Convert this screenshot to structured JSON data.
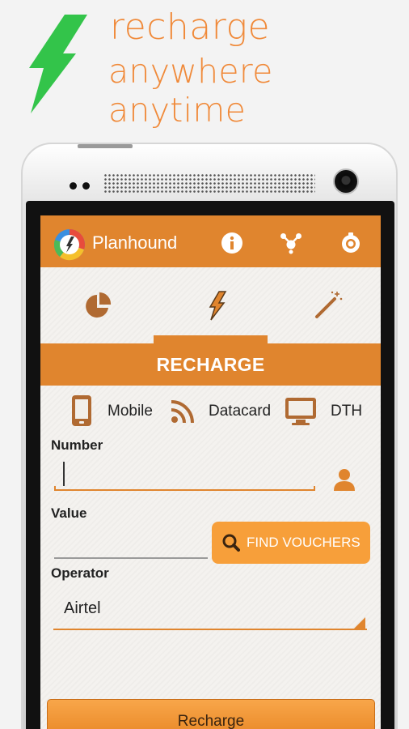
{
  "promo": {
    "line1": "recharge",
    "line2": "anywhere anytime",
    "icon": "lightning-bolt-icon",
    "accent_color": "#f08a3a",
    "bolt_color": "#33c44a"
  },
  "app": {
    "title": "Planhound",
    "bar_color": "#e0852e",
    "actions": [
      {
        "icon": "info-icon"
      },
      {
        "icon": "group-share-icon"
      },
      {
        "icon": "settings-icon"
      }
    ]
  },
  "tabs": [
    {
      "icon": "pie-chart-icon",
      "active": false
    },
    {
      "icon": "lightning-icon",
      "active": true
    },
    {
      "icon": "magic-wand-icon",
      "active": false
    }
  ],
  "section": {
    "title": "RECHARGE"
  },
  "types": [
    {
      "label": "Mobile",
      "icon": "mobile-icon"
    },
    {
      "label": "Datacard",
      "icon": "rss-icon"
    },
    {
      "label": "DTH",
      "icon": "monitor-icon"
    }
  ],
  "form": {
    "number_label": "Number",
    "number_value": "",
    "value_label": "Value",
    "value_value": "",
    "find_vouchers_label": "FIND VOUCHERS",
    "operator_label": "Operator",
    "operator_value": "Airtel"
  },
  "submit": {
    "label": "Recharge"
  }
}
